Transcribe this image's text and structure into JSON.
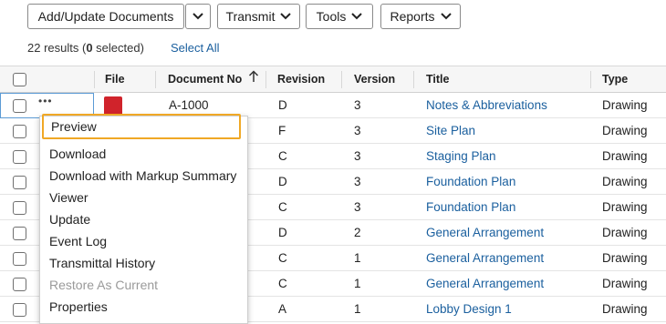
{
  "toolbar": {
    "add_update_label": "Add/Update Documents",
    "transmit_label": "Transmit",
    "tools_label": "Tools",
    "reports_label": "Reports"
  },
  "results": {
    "count_text": "22 results (",
    "selected_count": "0",
    "selected_suffix": " selected)",
    "select_all_label": "Select All"
  },
  "table": {
    "columns": {
      "file": "File",
      "document_no": "Document No",
      "revision": "Revision",
      "version": "Version",
      "title": "Title",
      "type": "Type"
    },
    "sort": {
      "column": "document_no",
      "direction": "ascending"
    },
    "rows": [
      {
        "document_no": "A-1000",
        "revision": "D",
        "version": "3",
        "title": "Notes & Abbreviations",
        "type": "Drawing"
      },
      {
        "document_no": "",
        "revision": "F",
        "version": "3",
        "title": "Site Plan",
        "type": "Drawing"
      },
      {
        "document_no": "",
        "revision": "C",
        "version": "3",
        "title": "Staging Plan",
        "type": "Drawing"
      },
      {
        "document_no": "",
        "revision": "D",
        "version": "3",
        "title": "Foundation Plan",
        "type": "Drawing"
      },
      {
        "document_no": "",
        "revision": "C",
        "version": "3",
        "title": "Foundation Plan",
        "type": "Drawing"
      },
      {
        "document_no": "",
        "revision": "D",
        "version": "2",
        "title": "General Arrangement",
        "type": "Drawing"
      },
      {
        "document_no": "",
        "revision": "C",
        "version": "1",
        "title": "General Arrangement",
        "type": "Drawing"
      },
      {
        "document_no": "",
        "revision": "C",
        "version": "1",
        "title": "General Arrangement",
        "type": "Drawing"
      },
      {
        "document_no": "",
        "revision": "A",
        "version": "1",
        "title": "Lobby Design 1",
        "type": "Drawing"
      }
    ]
  },
  "context_menu": {
    "items": [
      {
        "label": "Preview",
        "state": "highlighted"
      },
      {
        "label": "Download",
        "state": "enabled"
      },
      {
        "label": "Download with Markup Summary",
        "state": "enabled"
      },
      {
        "label": "Viewer",
        "state": "enabled"
      },
      {
        "label": "Update",
        "state": "enabled"
      },
      {
        "label": "Event Log",
        "state": "enabled"
      },
      {
        "label": "Transmittal History",
        "state": "enabled"
      },
      {
        "label": "Restore As Current",
        "state": "disabled"
      },
      {
        "label": "Properties",
        "state": "enabled"
      }
    ]
  },
  "colors": {
    "link": "#1a5f9e",
    "highlight_border": "#f0a825",
    "pdf_icon": "#d0232b",
    "focus_border": "#5b9bd5"
  },
  "icons": {
    "row_actions": "more-dots-icon",
    "file_type": "pdf-icon",
    "sort": "arrow-up-icon",
    "dropdown": "chevron-down-icon"
  }
}
